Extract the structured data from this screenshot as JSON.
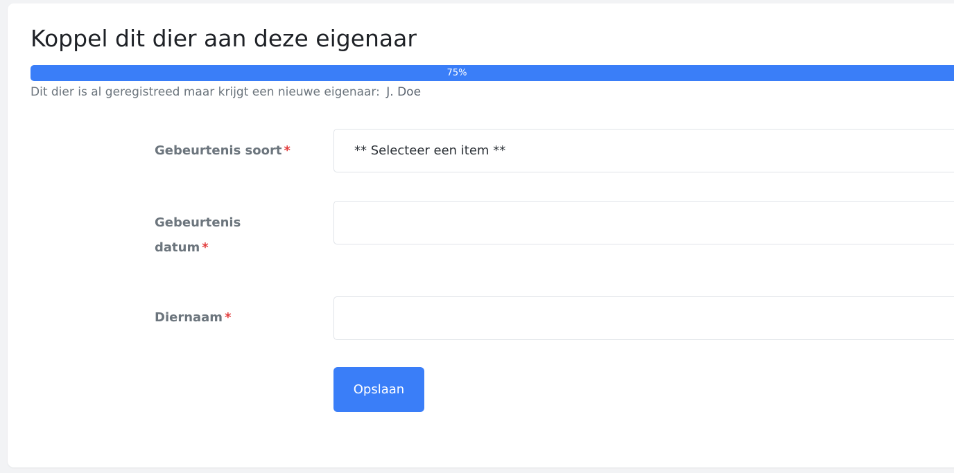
{
  "page": {
    "title": "Koppel dit dier aan deze eigenaar",
    "progress_label": "75%",
    "progress_value": 0.75,
    "subtitle": "Dit dier is al geregistreed maar krijgt een nieuwe eigenaar:",
    "owner_name": "J. Doe"
  },
  "form": {
    "event_type": {
      "label": "Gebeurtenis soort",
      "required_mark": "*",
      "selected": "** Selecteer een item **"
    },
    "event_date": {
      "label_line1": "Gebeurtenis",
      "label_line2": "datum",
      "required_mark": "*",
      "value": ""
    },
    "animal_name": {
      "label": "Diernaam",
      "required_mark": "*",
      "value": ""
    },
    "save_label": "Opslaan"
  },
  "colors": {
    "accent": "#3a7ef8",
    "required": "#e23b3b",
    "label": "#6c757d"
  }
}
